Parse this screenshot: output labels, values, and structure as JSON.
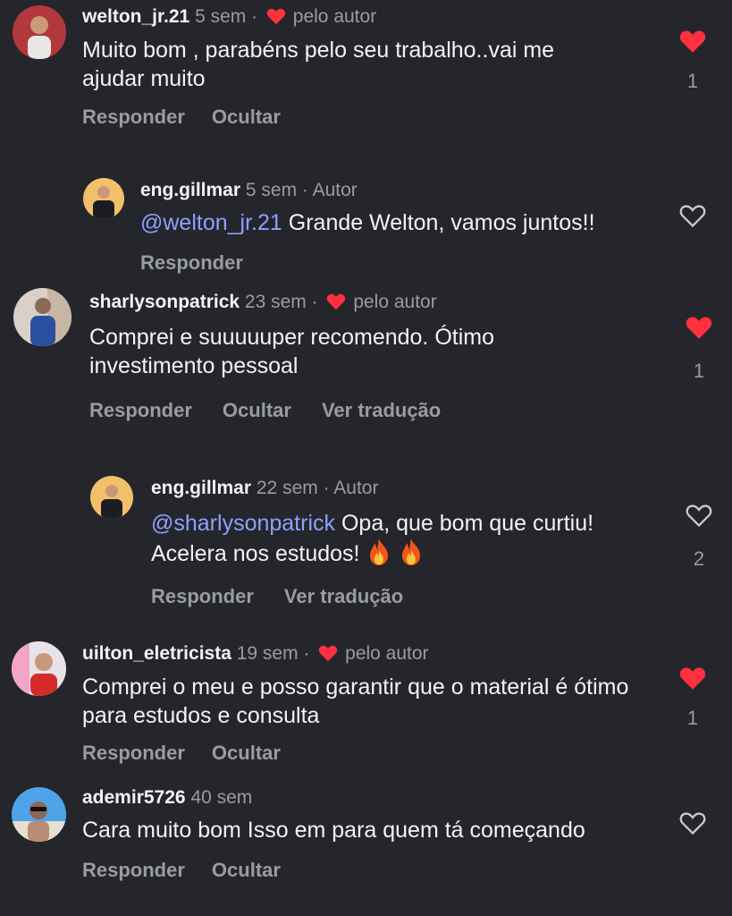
{
  "comments": [
    {
      "username": "welton_jr.21",
      "time": "5 sem",
      "liked_by_author": "pelo autor",
      "text": "Muito bom , parabéns pelo seu trabalho..vai me ajudar muito",
      "actions": [
        "Responder",
        "Ocultar"
      ],
      "likes": "1",
      "liked": true
    },
    {
      "username": "eng.gillmar",
      "time": "5 sem",
      "author_tag": "Autor",
      "mention": "@welton_jr.21",
      "text": "Grande Welton, vamos juntos!!",
      "actions": [
        "Responder"
      ],
      "liked": false
    },
    {
      "username": "sharlysonpatrick",
      "time": "23 sem",
      "liked_by_author": "pelo autor",
      "text": "Comprei e suuuuuper recomendo. Ótimo investimento pessoal",
      "actions": [
        "Responder",
        "Ocultar",
        "Ver tradução"
      ],
      "likes": "1",
      "liked": true
    },
    {
      "username": "eng.gillmar",
      "time": "22 sem",
      "author_tag": "Autor",
      "mention": "@sharlysonpatrick",
      "text": "Opa, que bom que curtiu! Acelera nos estudos!",
      "emoji": [
        "fire-icon",
        "fire-icon"
      ],
      "actions": [
        "Responder",
        "Ver tradução"
      ],
      "likes": "2",
      "liked": false
    },
    {
      "username": "uilton_eletricista",
      "time": "19 sem",
      "liked_by_author": "pelo autor",
      "text": "Comprei o meu e posso garantir que o material é ótimo para estudos e consulta",
      "actions": [
        "Responder",
        "Ocultar"
      ],
      "likes": "1",
      "liked": true
    },
    {
      "username": "ademir5726",
      "time": "40 sem",
      "text": "Cara muito bom Isso em para quem tá começando",
      "actions": [
        "Responder",
        "Ocultar"
      ],
      "liked": false
    }
  ],
  "colors": {
    "background": "#24262b",
    "liked_heart": "#ff3040",
    "mention": "#8ea0ff",
    "muted": "#9a9ca3"
  }
}
